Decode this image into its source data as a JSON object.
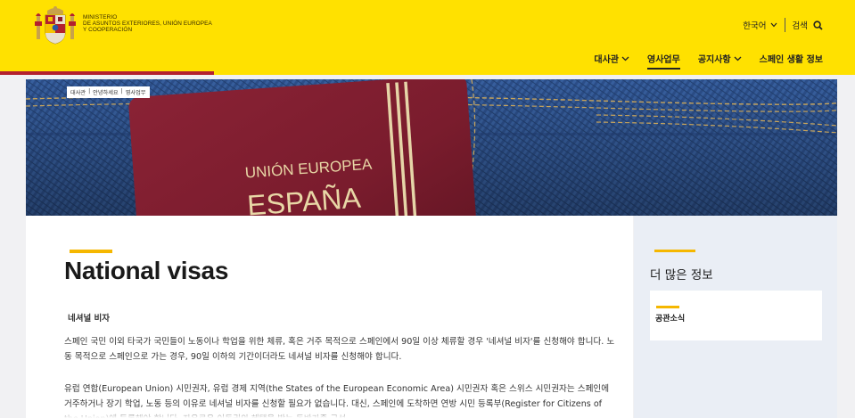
{
  "header": {
    "ministry_lines": [
      "MINISTERIO",
      "DE ASUNTOS EXTERIORES, UNIÓN EUROPEA",
      "Y COOPERACIÓN"
    ],
    "language": "한국어",
    "search_label": "검색",
    "nav": [
      {
        "label": "대사관",
        "has_dropdown": true,
        "active": false
      },
      {
        "label": "영사업무",
        "has_dropdown": false,
        "active": true
      },
      {
        "label": "공지사항",
        "has_dropdown": true,
        "active": false
      },
      {
        "label": "스페인 생활 정보",
        "has_dropdown": false,
        "active": false
      }
    ]
  },
  "breadcrumb": [
    "대사관",
    "안녕하세요",
    "영사업무"
  ],
  "hero": {
    "passport_line1": "UNIÓN EUROPEA",
    "passport_line2": "ESPAÑA"
  },
  "main": {
    "title": "National visas",
    "subtitle": "네셔널 비자",
    "para1": "스페인 국민 이외 타국가 국민들이 노동이나 학업을 위한 체류, 혹은 거주 목적으로 스페인에서 90일 이상 체류할 경우 '네셔널 비자'를 신청해야 합니다. 노동 목적으로 스페인으로 가는 경우, 90일 이하의 기간이더라도 네셔널 비자를 신청해야 합니다.",
    "para2": "유럽 연합(European Union) 시민권자, 유럽 경제 지역(the States of the European Economic Area) 시민권자 혹은 스위스 시민권자는 스페인에 거주하거나 장기 학업, 노동 등의 이유로 네셔널 비자를 신청할 필요가 없습니다. 대신, 스페인에 도착하면 연방 시민 등록부(Register for Citizens of the Union)에 등록해야 합니다. 자유로운 이동권의 혜택을 받는 동반가족 구성"
  },
  "sidebar": {
    "title": "더 많은 정보",
    "card_label": "공관소식"
  },
  "colors": {
    "header_yellow": "#ffe100",
    "brand_red": "#b3212e",
    "accent_gold": "#f5b700",
    "passport_burgundy": "#7c1d2e",
    "denim_blue": "#2b4e8b"
  }
}
